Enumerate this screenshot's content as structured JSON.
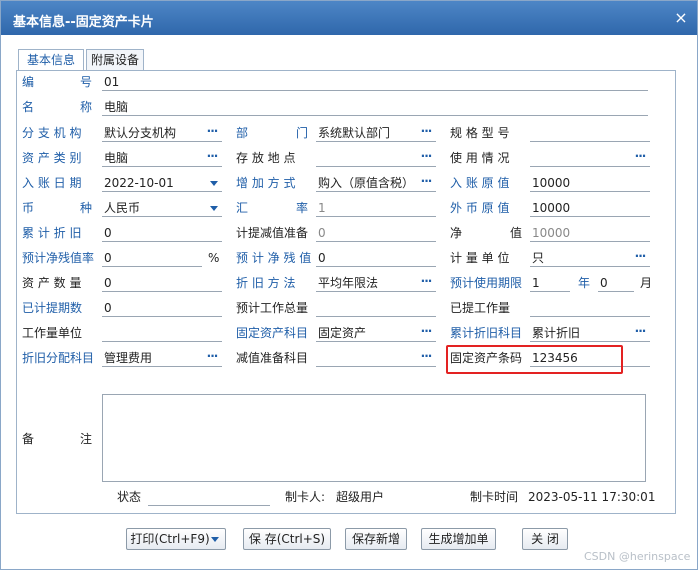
{
  "window": {
    "title": "基本信息--固定资产卡片",
    "close_glyph": "×"
  },
  "tabs": [
    {
      "label": "基本信息",
      "active": true
    },
    {
      "label": "附属设备",
      "active": false
    }
  ],
  "labels": {
    "bianhao_1": "编",
    "bianhao_2": "号",
    "mingcheng_1": "名",
    "mingcheng_2": "称",
    "fenzhi": "分 支 机 构",
    "bumen_1": "部",
    "bumen_2": "门",
    "guige": "规 格 型 号",
    "zichan_leibie": "资 产 类 别",
    "cunfang": "存 放 地 点",
    "shiyong": "使 用 情 况",
    "ruzhang": "入 账 日 期",
    "zengjia": "增 加 方 式",
    "ruzhang_yuanzhi": "入 账 原 值",
    "bi_1": "币",
    "bi_2": "种",
    "huilv_1": "汇",
    "huilv_2": "率",
    "waibi_yuanzhi": "外 币 原 值",
    "leiji_zhejiu": "累 计 折 旧",
    "jiti_jianzhi": "计提减值准备",
    "jingzhi_1": "净",
    "jingzhi_2": "值",
    "yuji_canzhilv": "预计净残值率",
    "pct": "%",
    "yuji_canzhi": "预 计 净 残 值",
    "jiliang": "计 量 单 位",
    "zichan_shuliang": "资 产 数 量",
    "zhejiu_fangfa": "折 旧 方 法",
    "yuji_qixian": "预计使用期限",
    "nian": "年",
    "yue": "月",
    "yiti_qishu": "已计提期数",
    "yuji_gongzuo": "预计工作总量",
    "yiti_gongzuo": "已提工作量",
    "gongzuo_danwei": "工作量单位",
    "gdzc_kemu": "固定资产科目",
    "leiji_kemu": "累计折旧科目",
    "fenpei_kemu": "折旧分配科目",
    "jianzhi_kemu": "减值准备科目",
    "tiaoma": "固定资产条码",
    "beizhu_1": "备",
    "beizhu_2": "注",
    "zhuangtai": "状态",
    "zhikaren": "制卡人:",
    "zhikashijian": "制卡时间"
  },
  "values": {
    "bianhao": "01",
    "mingcheng": "电脑",
    "fenzhi": "默认分支机构",
    "bumen": "系统默认部门",
    "guige": "",
    "zichan_leibie": "电脑",
    "cunfang": "",
    "shiyong": "",
    "ruzhang": "2022-10-01",
    "zengjia": "购入（原值含税）",
    "ruzhang_yuanzhi": "10000",
    "bi": "人民币",
    "huilv": "1",
    "waibi_yuanzhi": "10000",
    "leiji_zhejiu": "0",
    "jiti_jianzhi": "0",
    "jingzhi": "10000",
    "yuji_canzhilv": "0",
    "yuji_canzhi": "0",
    "jiliang": "只",
    "zichan_shuliang": "0",
    "zhejiu_fangfa": "平均年限法",
    "qixian_nian": "1",
    "qixian_yue": "0",
    "yiti_qishu": "0",
    "yuji_gongzuo": "",
    "yiti_gongzuo": "",
    "gongzuo_danwei": "",
    "gdzc_kemu": "固定资产",
    "leiji_kemu": "累计折旧",
    "fenpei_kemu": "管理费用",
    "jianzhi_kemu": "",
    "tiaoma": "123456",
    "zhuangtai": "",
    "zhikaren": "超级用户",
    "zhikashijian": "2023-05-11 17:30:01"
  },
  "buttons": {
    "print": "打印(Ctrl+F9)",
    "save": "保 存(Ctrl+S)",
    "save_new": "保存新增",
    "gen_add": "生成增加单",
    "close": "关 闭"
  },
  "icons": {
    "lookup": "···",
    "dropdown": "chevron-down-icon",
    "close": "close-icon"
  },
  "colors": {
    "label_blue": "#1f5ea8",
    "title_bar": "#2f67ab",
    "highlight": "#e32222"
  },
  "watermark": "CSDN @herinspace"
}
